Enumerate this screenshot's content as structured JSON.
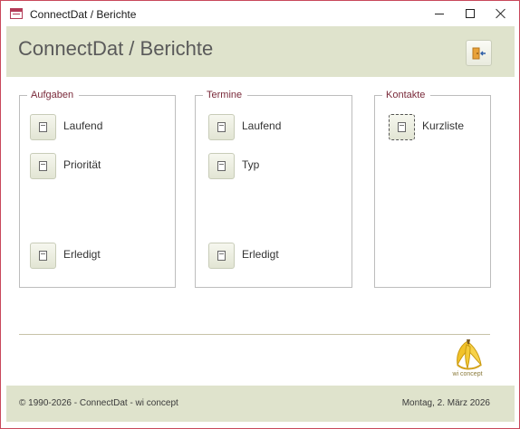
{
  "window": {
    "title": "ConnectDat / Berichte"
  },
  "header": {
    "title": "ConnectDat / Berichte",
    "exit_icon": "exit-door-icon"
  },
  "groups": {
    "aufgaben": {
      "label": "Aufgaben",
      "items": [
        {
          "label": "Laufend",
          "icon": "report-icon"
        },
        {
          "label": "Priorität",
          "icon": "report-icon"
        },
        {
          "label": "Erledigt",
          "icon": "report-icon"
        }
      ]
    },
    "termine": {
      "label": "Termine",
      "items": [
        {
          "label": "Laufend",
          "icon": "report-icon"
        },
        {
          "label": "Typ",
          "icon": "report-icon"
        },
        {
          "label": "Erledigt",
          "icon": "report-icon"
        }
      ]
    },
    "kontakte": {
      "label": "Kontakte",
      "items": [
        {
          "label": "Kurzliste",
          "icon": "report-icon"
        }
      ]
    }
  },
  "logo": {
    "text": "wi concept"
  },
  "footer": {
    "copyright": "© 1990-2026 - ConnectDat - wi concept",
    "date": "Montag, 2. März 2026"
  },
  "colors": {
    "accent_band": "#dfe3cc",
    "window_border": "#c9485b",
    "group_label": "#7a2a3a"
  }
}
